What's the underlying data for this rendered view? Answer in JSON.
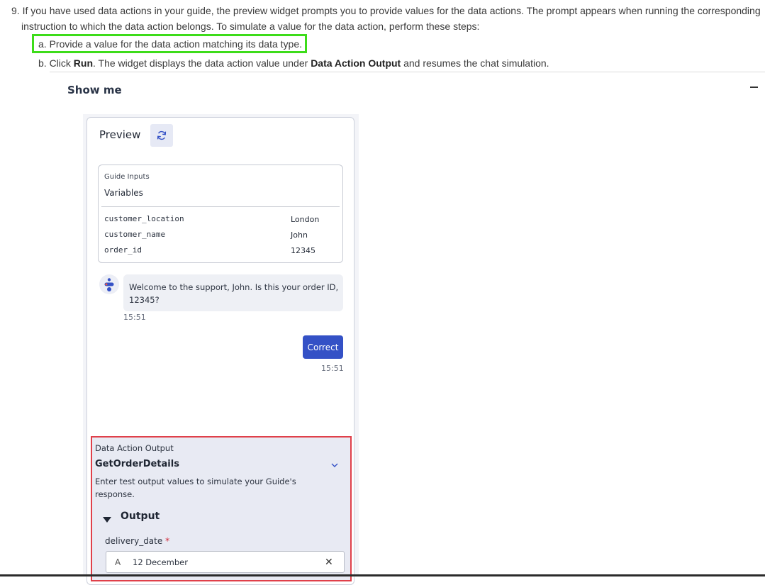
{
  "doc": {
    "step9_line1": "9. If you have used data actions in your guide, the preview widget prompts you to provide values for the data actions. The prompt appears when running the corresponding",
    "step9_line2": "instruction to which the data action belongs. To simulate a value for the data action, perform these steps:",
    "step_a": "a. Provide a value for the data action matching its data type.",
    "step_b_prefix": "b. Click ",
    "step_b_run": "Run",
    "step_b_mid": ". The widget displays the data action value under ",
    "step_b_dao": "Data Action Output",
    "step_b_suffix": " and resumes the chat simulation.",
    "show_me": "Show me",
    "collapse_icon": "minus-icon"
  },
  "preview": {
    "title": "Preview",
    "refresh_icon": "refresh-icon",
    "guide_inputs_label": "Guide Inputs",
    "variables_label": "Variables",
    "variables": [
      {
        "name": "customer_location",
        "value": "London"
      },
      {
        "name": "customer_name",
        "value": "John"
      },
      {
        "name": "order_id",
        "value": "12345"
      }
    ],
    "bot_message": "Welcome to the support, John. Is this your order ID, 12345?",
    "bot_time": "15:51",
    "user_message": "Correct",
    "user_time": "15:51"
  },
  "data_action_output": {
    "label": "Data Action Output",
    "name": "GetOrderDetails",
    "description": "Enter test output values to simulate your Guide's response.",
    "output_label": "Output",
    "field_label": "delivery_date",
    "required_mark": "*",
    "field_type_glyph": "A",
    "field_value": "12 December",
    "clear_glyph": "✕"
  },
  "colors": {
    "highlight_green": "#3ddc1a",
    "highlight_red": "#e0404a",
    "primary_button": "#3451c6"
  }
}
